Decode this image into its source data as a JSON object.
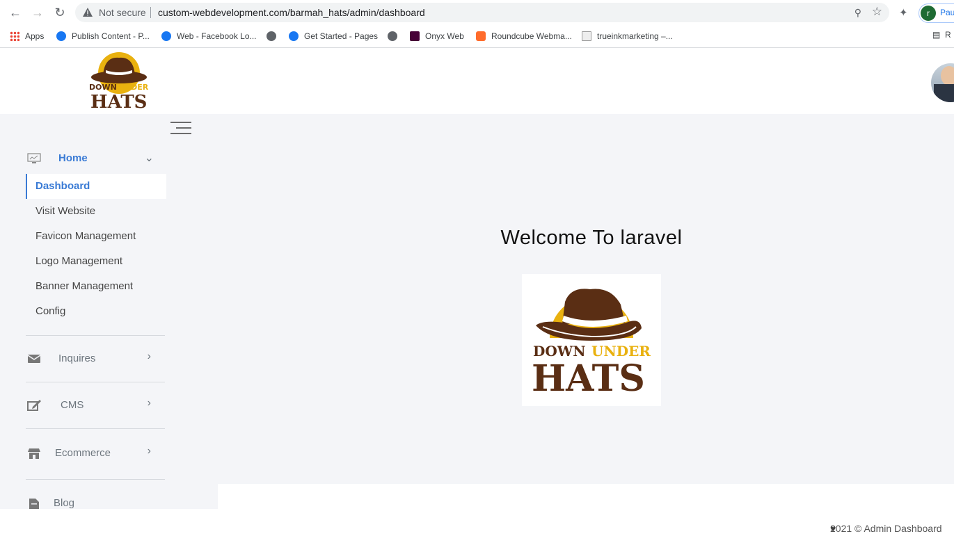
{
  "browser": {
    "security_label": "Not secure",
    "url": "custom-webdevelopment.com/barmah_hats/admin/dashboard",
    "profile_initial": "r",
    "profile_name": "Pau",
    "bookmarks": [
      {
        "label": "Apps",
        "icon": "apps-grid-icon"
      },
      {
        "label": "Publish Content - P...",
        "icon": "facebook-icon"
      },
      {
        "label": "Web - Facebook Lo...",
        "icon": "facebook-icon"
      },
      {
        "label": "",
        "icon": "globe-icon"
      },
      {
        "label": "Get Started - Pages",
        "icon": "facebook-icon"
      },
      {
        "label": "",
        "icon": "globe-icon"
      },
      {
        "label": "Onyx Web",
        "icon": "adobe-xd-icon"
      },
      {
        "label": "Roundcube Webma...",
        "icon": "cpanel-icon"
      },
      {
        "label": "trueinkmarketing –...",
        "icon": "trueink-icon"
      }
    ],
    "reading_list_label": "R"
  },
  "header": {
    "logo_alt": "DOWN UNDER HATS",
    "logo_text": {
      "line1a": "DOWN",
      "line1b": "UNDER",
      "line2": "HATS"
    }
  },
  "sidebar": {
    "home": {
      "label": "Home",
      "icon": "monitor-icon"
    },
    "home_items": [
      "Dashboard",
      "Visit Website",
      "Favicon Management",
      "Logo Management",
      "Banner Management",
      "Config"
    ],
    "sections": [
      {
        "label": "Inquires",
        "icon": "envelope-icon"
      },
      {
        "label": "CMS",
        "icon": "edit-icon"
      },
      {
        "label": "Ecommerce",
        "icon": "store-icon"
      },
      {
        "label": "Blog",
        "icon": "file-icon"
      }
    ]
  },
  "main": {
    "welcome": "Welcome To laravel"
  },
  "footer": {
    "text": "2021 © Admin Dashboard"
  },
  "colors": {
    "accent": "#3a7bd5",
    "content_bg": "#f4f5f8",
    "logo_yellow": "#e9b10f",
    "logo_brown": "#5a2e14"
  }
}
